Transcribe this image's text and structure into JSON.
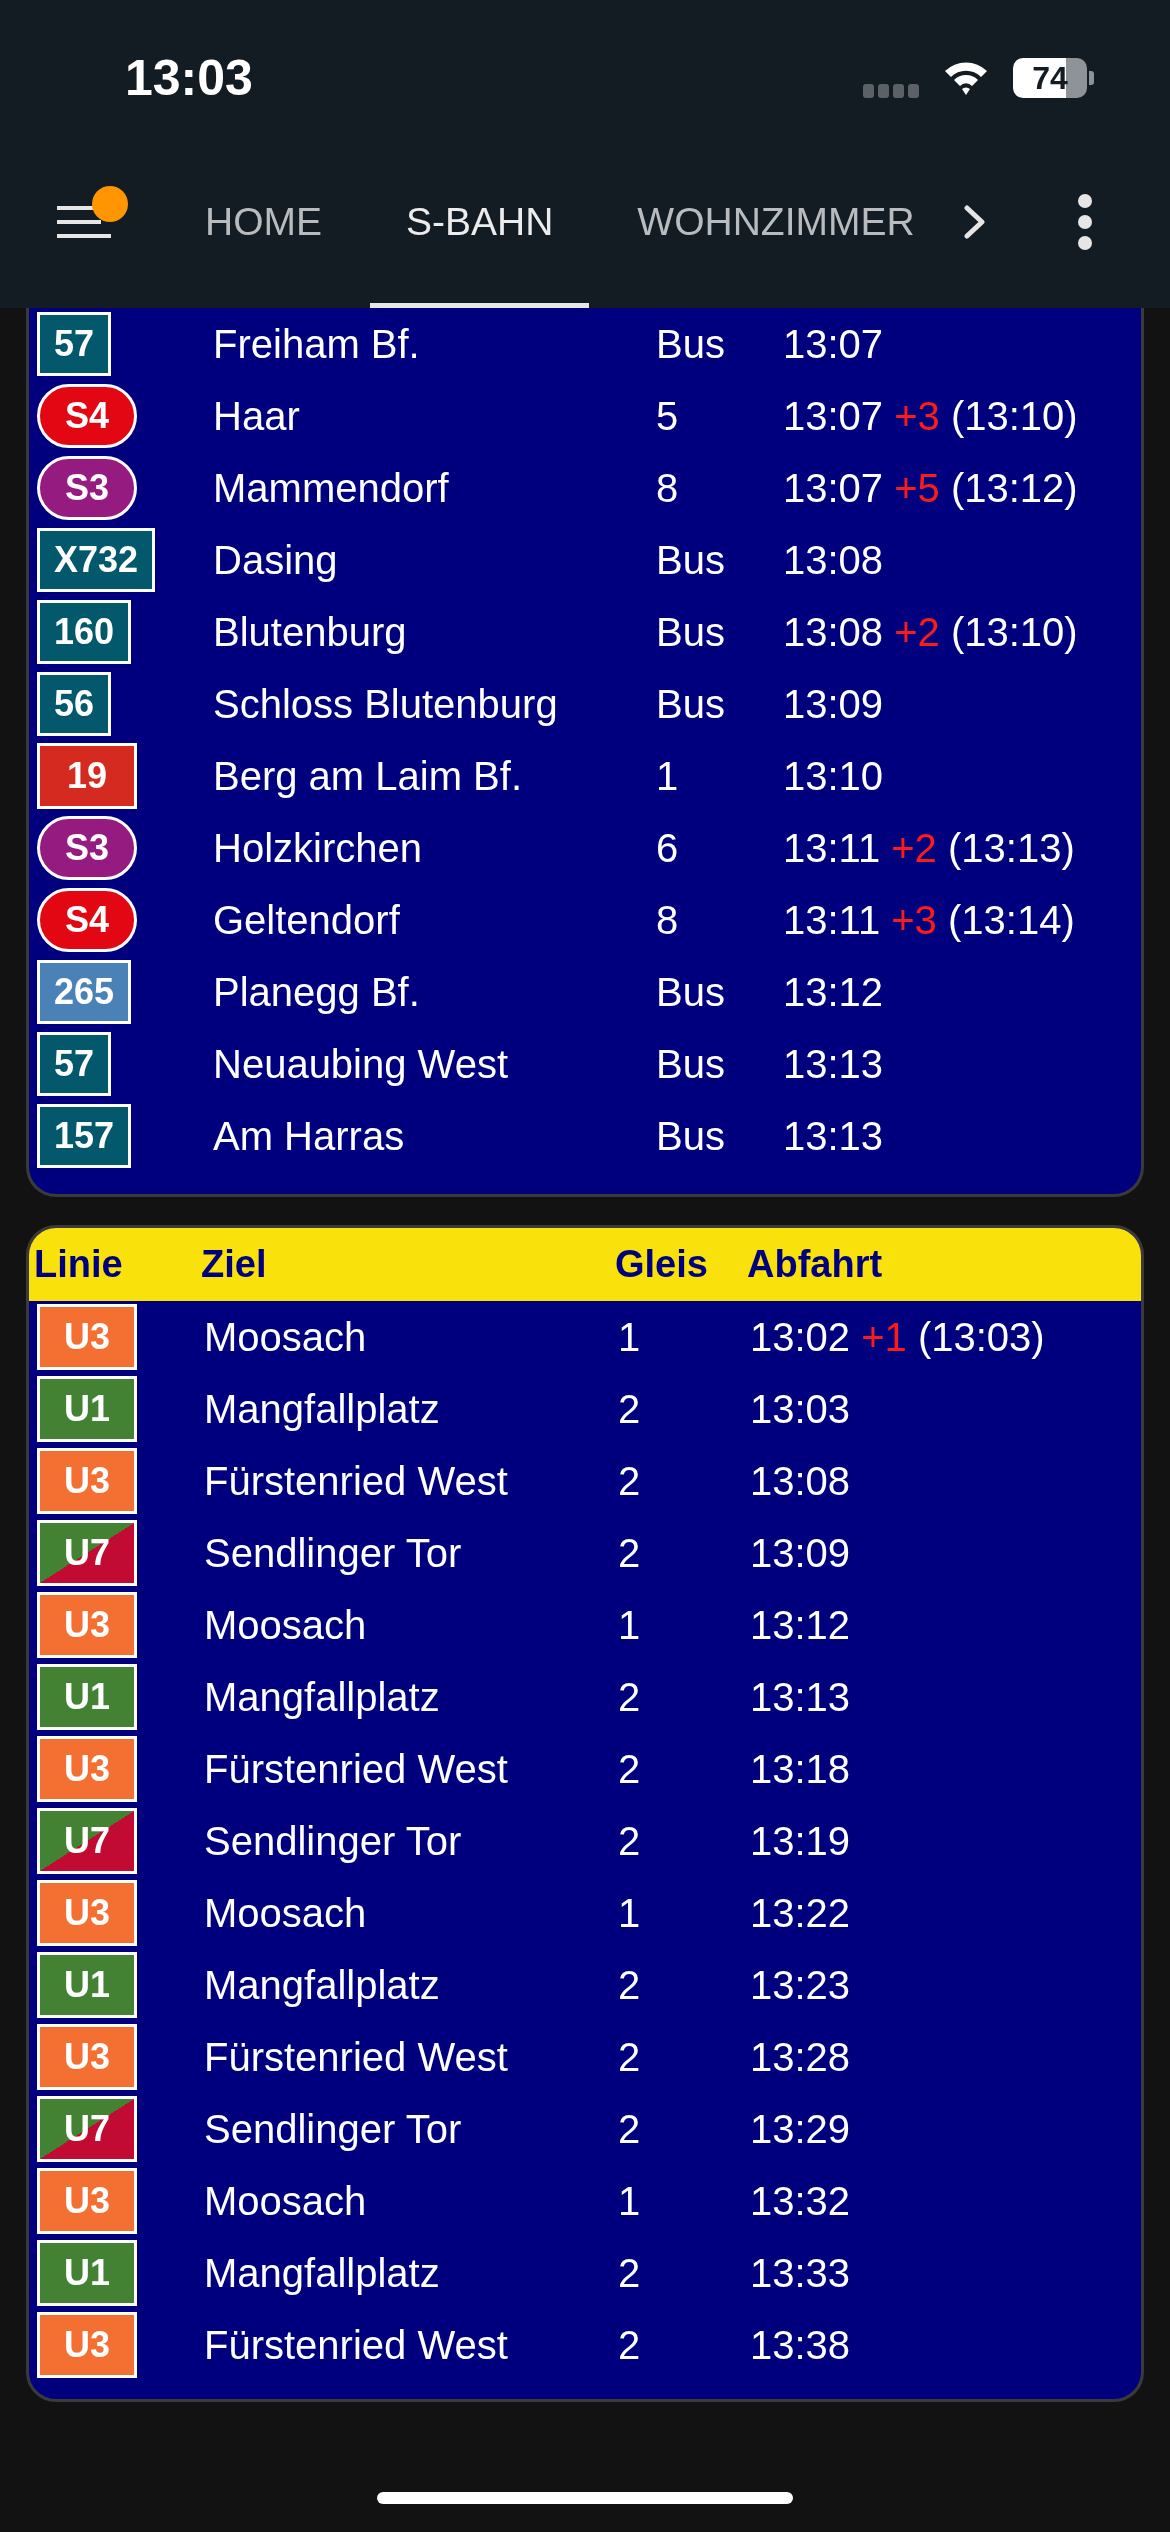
{
  "status_bar": {
    "time": "13:03",
    "battery": "74"
  },
  "app_bar": {
    "menu": {
      "notification": true
    },
    "tabs": [
      {
        "label": "HOME",
        "selected": false
      },
      {
        "label": "S-BAHN",
        "selected": true
      },
      {
        "label": "WOHNZIMMER",
        "selected": false
      }
    ]
  },
  "boards": [
    {
      "rows": [
        {
          "line": {
            "label": "57",
            "kind": "bus",
            "color": "#03596b"
          },
          "destination": "Freiham Bf.",
          "platform": "Bus",
          "time": "13:07"
        },
        {
          "line": {
            "label": "S4",
            "kind": "sbahn",
            "color": "#e30613"
          },
          "destination": "Haar",
          "platform": "5",
          "time": "13:07",
          "delay": "+3",
          "actual": "(13:10)"
        },
        {
          "line": {
            "label": "S3",
            "kind": "sbahn",
            "color": "#951b81"
          },
          "destination": "Mammendorf",
          "platform": "8",
          "time": "13:07",
          "delay": "+5",
          "actual": "(13:12)"
        },
        {
          "line": {
            "label": "X732",
            "kind": "bus",
            "color": "#03596b"
          },
          "destination": "Dasing",
          "platform": "Bus",
          "time": "13:08"
        },
        {
          "line": {
            "label": "160",
            "kind": "bus",
            "color": "#03596b"
          },
          "destination": "Blutenburg",
          "platform": "Bus",
          "time": "13:08",
          "delay": "+2",
          "actual": "(13:10)"
        },
        {
          "line": {
            "label": "56",
            "kind": "bus",
            "color": "#03596b"
          },
          "destination": "Schloss Blutenburg",
          "platform": "Bus",
          "time": "13:09"
        },
        {
          "line": {
            "label": "19",
            "kind": "tram",
            "color": "#d42a20"
          },
          "destination": "Berg am Laim Bf.",
          "platform": "1",
          "time": "13:10"
        },
        {
          "line": {
            "label": "S3",
            "kind": "sbahn",
            "color": "#951b81"
          },
          "destination": "Holzkirchen",
          "platform": "6",
          "time": "13:11",
          "delay": "+2",
          "actual": "(13:13)"
        },
        {
          "line": {
            "label": "S4",
            "kind": "sbahn",
            "color": "#e30613"
          },
          "destination": "Geltendorf",
          "platform": "8",
          "time": "13:11",
          "delay": "+3",
          "actual": "(13:14)"
        },
        {
          "line": {
            "label": "265",
            "kind": "bus",
            "color": "#4a82b7"
          },
          "destination": "Planegg Bf.",
          "platform": "Bus",
          "time": "13:12"
        },
        {
          "line": {
            "label": "57",
            "kind": "bus",
            "color": "#03596b"
          },
          "destination": "Neuaubing West",
          "platform": "Bus",
          "time": "13:13"
        },
        {
          "line": {
            "label": "157",
            "kind": "bus",
            "color": "#03596b"
          },
          "destination": "Am Harras",
          "platform": "Bus",
          "time": "13:13"
        }
      ]
    },
    {
      "columns": [
        "Linie",
        "Ziel",
        "Gleis",
        "Abfahrt"
      ],
      "rows": [
        {
          "line": {
            "label": "U3",
            "kind": "ubahn",
            "color": "#f36f32"
          },
          "destination": "Moosach",
          "platform": "1",
          "time": "13:02",
          "delay": "+1",
          "actual": "(13:03)"
        },
        {
          "line": {
            "label": "U1",
            "kind": "ubahn",
            "color": "#438133"
          },
          "destination": "Mangfallplatz",
          "platform": "2",
          "time": "13:03"
        },
        {
          "line": {
            "label": "U3",
            "kind": "ubahn",
            "color": "#f36f32"
          },
          "destination": "Fürstenried West",
          "platform": "2",
          "time": "13:08"
        },
        {
          "line": {
            "label": "U7",
            "kind": "ubahn",
            "color": "#438133",
            "split": {
              "color": "#c20b33"
            }
          },
          "destination": "Sendlinger Tor",
          "platform": "2",
          "time": "13:09"
        },
        {
          "line": {
            "label": "U3",
            "kind": "ubahn",
            "color": "#f36f32"
          },
          "destination": "Moosach",
          "platform": "1",
          "time": "13:12"
        },
        {
          "line": {
            "label": "U1",
            "kind": "ubahn",
            "color": "#438133"
          },
          "destination": "Mangfallplatz",
          "platform": "2",
          "time": "13:13"
        },
        {
          "line": {
            "label": "U3",
            "kind": "ubahn",
            "color": "#f36f32"
          },
          "destination": "Fürstenried West",
          "platform": "2",
          "time": "13:18"
        },
        {
          "line": {
            "label": "U7",
            "kind": "ubahn",
            "color": "#438133",
            "split": {
              "color": "#c20b33"
            }
          },
          "destination": "Sendlinger Tor",
          "platform": "2",
          "time": "13:19"
        },
        {
          "line": {
            "label": "U3",
            "kind": "ubahn",
            "color": "#f36f32"
          },
          "destination": "Moosach",
          "platform": "1",
          "time": "13:22"
        },
        {
          "line": {
            "label": "U1",
            "kind": "ubahn",
            "color": "#438133"
          },
          "destination": "Mangfallplatz",
          "platform": "2",
          "time": "13:23"
        },
        {
          "line": {
            "label": "U3",
            "kind": "ubahn",
            "color": "#f36f32"
          },
          "destination": "Fürstenried West",
          "platform": "2",
          "time": "13:28"
        },
        {
          "line": {
            "label": "U7",
            "kind": "ubahn",
            "color": "#438133",
            "split": {
              "color": "#c20b33"
            }
          },
          "destination": "Sendlinger Tor",
          "platform": "2",
          "time": "13:29"
        },
        {
          "line": {
            "label": "U3",
            "kind": "ubahn",
            "color": "#f36f32"
          },
          "destination": "Moosach",
          "platform": "1",
          "time": "13:32"
        },
        {
          "line": {
            "label": "U1",
            "kind": "ubahn",
            "color": "#438133"
          },
          "destination": "Mangfallplatz",
          "platform": "2",
          "time": "13:33"
        },
        {
          "line": {
            "label": "U3",
            "kind": "ubahn",
            "color": "#f36f32"
          },
          "destination": "Fürstenried West",
          "platform": "2",
          "time": "13:38"
        }
      ]
    }
  ]
}
